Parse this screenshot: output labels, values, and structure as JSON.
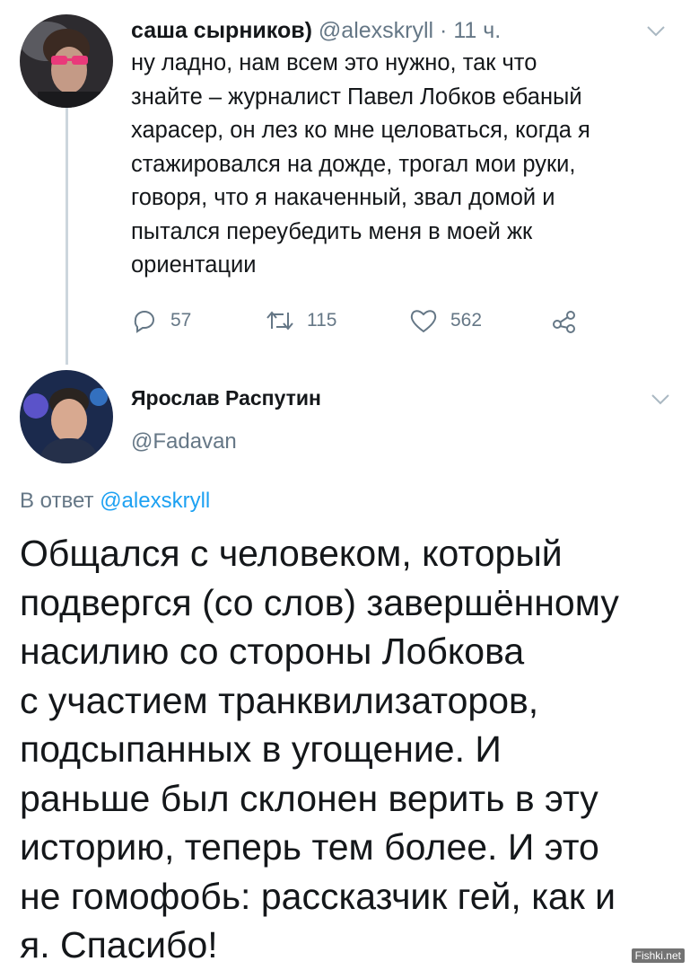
{
  "tweet1": {
    "author_name": "саша сырников)",
    "author_handle": "@alexskryll",
    "separator": "·",
    "time": "11 ч.",
    "text_lines": [
      "ну ладно, нам всем это нужно, так что",
      "знайте – журналист Павел Лобков ебаный",
      "харасер, он лез ко мне целоваться, когда я",
      "стажировался на дожде, трогал мои руки,",
      "говоря, что я накаченный, звал домой и",
      "пытался переубедить меня в моей жк",
      "ориентации"
    ],
    "replies": "57",
    "retweets": "115",
    "likes": "562"
  },
  "tweet2": {
    "author_name": "Ярослав Распутин",
    "author_handle": "@Fadavan",
    "reply_prefix": "В ответ",
    "reply_mention": "@alexskryll",
    "text_lines": [
      "Общался с человеком, который",
      "подвергся (со слов) завершённому",
      "насилию со стороны Лобкова",
      "с участием транквилизаторов,",
      "подсыпанных в угощение. И",
      "раньше был склонен верить в эту",
      "историю, теперь тем более.  И это",
      "не гомофобь: рассказчик гей, как и",
      "я. Спасибо!"
    ]
  },
  "watermark": "Fishki.net",
  "icons": {
    "reply": "reply-icon",
    "retweet": "retweet-icon",
    "like": "heart-icon",
    "share": "share-icon",
    "menu": "chevron-down-icon"
  },
  "colors": {
    "text": "#14171a",
    "secondary": "#657786",
    "link": "#1da1f2",
    "thread_line": "#ccd6dd"
  }
}
